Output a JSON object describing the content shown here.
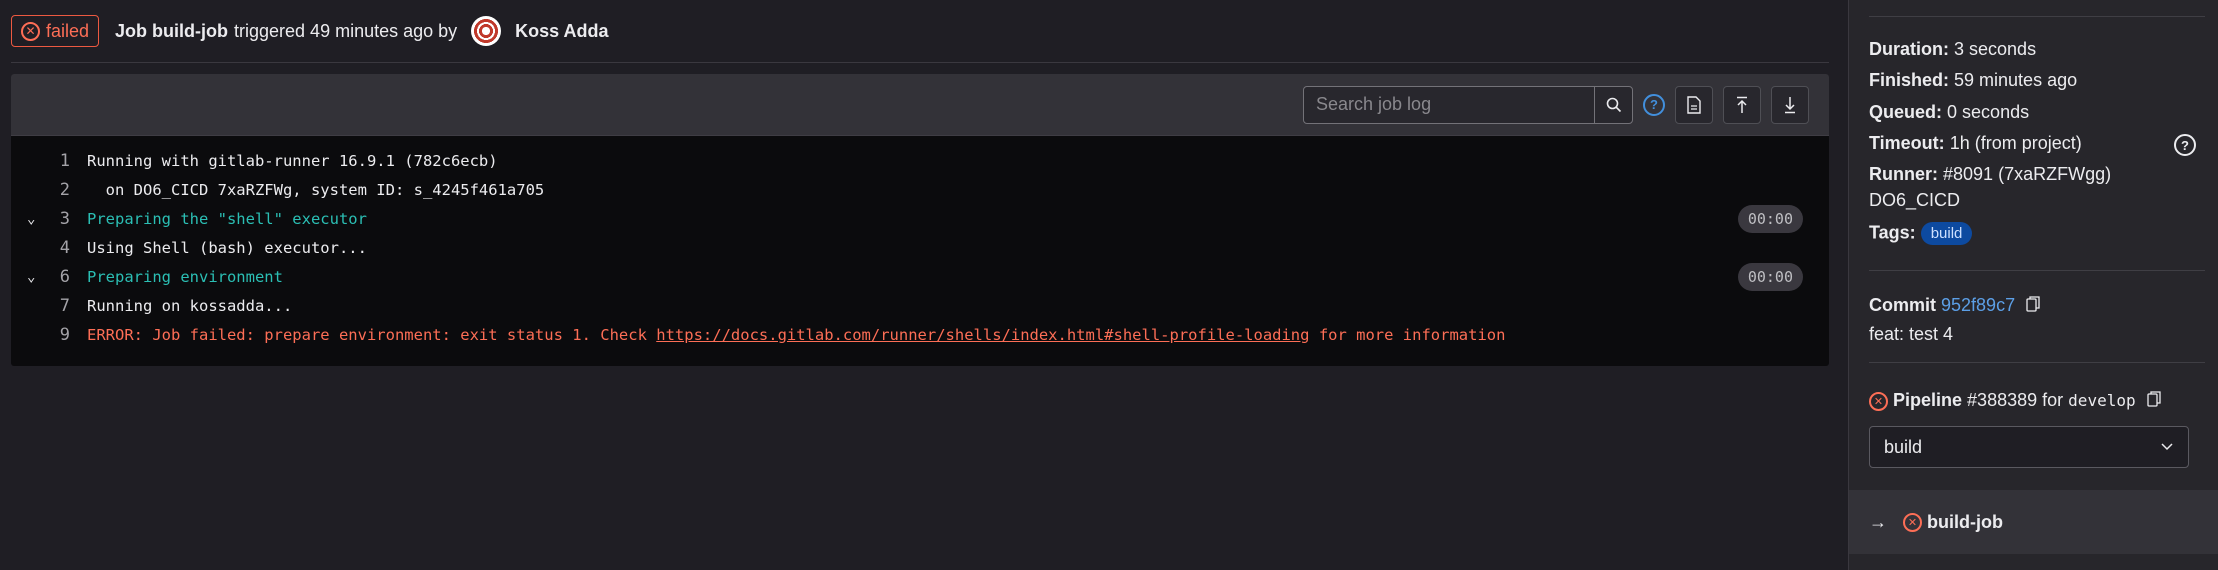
{
  "header": {
    "status": "failed",
    "job_label": "Job build-job",
    "triggered_text": "triggered 49 minutes ago by",
    "user": "Koss Adda"
  },
  "log_toolbar": {
    "search_placeholder": "Search job log",
    "icons": [
      "search-icon",
      "help-icon",
      "raw-log-icon",
      "scroll-top-icon",
      "scroll-bottom-icon"
    ]
  },
  "log": {
    "lines": [
      {
        "num": "1",
        "text": "Running with gitlab-runner 16.9.1 (782c6ecb)",
        "kind": "normal",
        "collapsible": false,
        "duration": ""
      },
      {
        "num": "2",
        "text": "  on DO6_CICD 7xaRZFWg, system ID: s_4245f461a705",
        "kind": "normal",
        "collapsible": false,
        "duration": ""
      },
      {
        "num": "3",
        "text": "Preparing the \"shell\" executor",
        "kind": "section",
        "collapsible": true,
        "duration": "00:00"
      },
      {
        "num": "4",
        "text": "Using Shell (bash) executor...",
        "kind": "normal",
        "collapsible": false,
        "duration": ""
      },
      {
        "num": "6",
        "text": "Preparing environment",
        "kind": "section",
        "collapsible": true,
        "duration": "00:00"
      },
      {
        "num": "7",
        "text": "Running on kossadda...",
        "kind": "normal",
        "collapsible": false,
        "duration": ""
      }
    ],
    "error_line": {
      "num": "9",
      "prefix": "ERROR: Job failed: prepare environment: exit status 1. Check ",
      "link": "https://docs.gitlab.com/runner/shells/index.html#shell-profile-loading",
      "suffix": " for more information"
    }
  },
  "sidebar": {
    "duration_label": "Duration:",
    "duration": "3 seconds",
    "finished_label": "Finished:",
    "finished": "59 minutes ago",
    "queued_label": "Queued:",
    "queued": "0 seconds",
    "timeout_label": "Timeout:",
    "timeout": "1h (from project)",
    "runner_label": "Runner:",
    "runner": "#8091 (7xaRZFWgg)",
    "runner_name": "DO6_CICD",
    "tags_label": "Tags:",
    "tag": "build",
    "commit_label": "Commit",
    "commit_sha": "952f89c7",
    "commit_title": "feat: test 4",
    "pipeline_label": "Pipeline",
    "pipeline_id": "#388389",
    "pipeline_for": "for",
    "pipeline_ref": "develop",
    "stage_selected": "build",
    "job_name": "build-job"
  },
  "colors": {
    "failed": "#fd6e56",
    "section": "#2bbfb4",
    "link": "#5c9fe6",
    "tag_bg": "#0d4aa0"
  }
}
